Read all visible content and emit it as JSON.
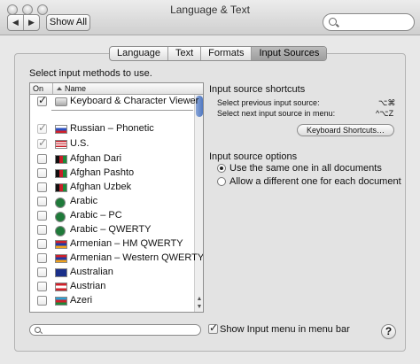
{
  "window": {
    "title": "Language & Text",
    "nav_back": "◀",
    "nav_forward": "▶",
    "show_all": "Show All"
  },
  "tabs": [
    {
      "label": "Language",
      "active": false
    },
    {
      "label": "Text",
      "active": false
    },
    {
      "label": "Formats",
      "active": false
    },
    {
      "label": "Input Sources",
      "active": true
    }
  ],
  "list": {
    "prompt": "Select input methods to use.",
    "header_on": "On",
    "header_name": "Name",
    "items": [
      {
        "label": "Keyboard & Character Viewer",
        "checked": true,
        "icon": "keyboard-icon",
        "dim": false
      },
      {
        "label": "Russian – Phonetic",
        "checked": true,
        "icon": "flag-russia",
        "dim": true
      },
      {
        "label": "U.S.",
        "checked": true,
        "icon": "flag-us",
        "dim": true
      },
      {
        "label": "Afghan Dari",
        "checked": false,
        "icon": "flag-afghanistan",
        "dim": false
      },
      {
        "label": "Afghan Pashto",
        "checked": false,
        "icon": "flag-afghanistan",
        "dim": false
      },
      {
        "label": "Afghan Uzbek",
        "checked": false,
        "icon": "flag-afghanistan",
        "dim": false
      },
      {
        "label": "Arabic",
        "checked": false,
        "icon": "crescent-icon",
        "dim": false
      },
      {
        "label": "Arabic – PC",
        "checked": false,
        "icon": "crescent-icon",
        "dim": false
      },
      {
        "label": "Arabic – QWERTY",
        "checked": false,
        "icon": "crescent-icon",
        "dim": false
      },
      {
        "label": "Armenian – HM QWERTY",
        "checked": false,
        "icon": "flag-armenia",
        "dim": false
      },
      {
        "label": "Armenian – Western QWERTY",
        "checked": false,
        "icon": "flag-armenia",
        "dim": false
      },
      {
        "label": "Australian",
        "checked": false,
        "icon": "flag-australia",
        "dim": false
      },
      {
        "label": "Austrian",
        "checked": false,
        "icon": "flag-austria",
        "dim": false
      },
      {
        "label": "Azeri",
        "checked": false,
        "icon": "flag-azerbaijan",
        "dim": false
      }
    ]
  },
  "shortcuts": {
    "heading": "Input source shortcuts",
    "prev_label": "Select previous input source:",
    "prev_key": "⌥⌘",
    "next_label": "Select next input source in menu:",
    "next_key": "^⌥Z",
    "button": "Keyboard Shortcuts…"
  },
  "options": {
    "heading": "Input source options",
    "same_all": "Use the same one in all documents",
    "different_each": "Allow a different one for each document",
    "selected": "same_all"
  },
  "bottom": {
    "show_menu_label": "Show Input menu in menu bar",
    "show_menu_checked": true,
    "help": "?"
  }
}
